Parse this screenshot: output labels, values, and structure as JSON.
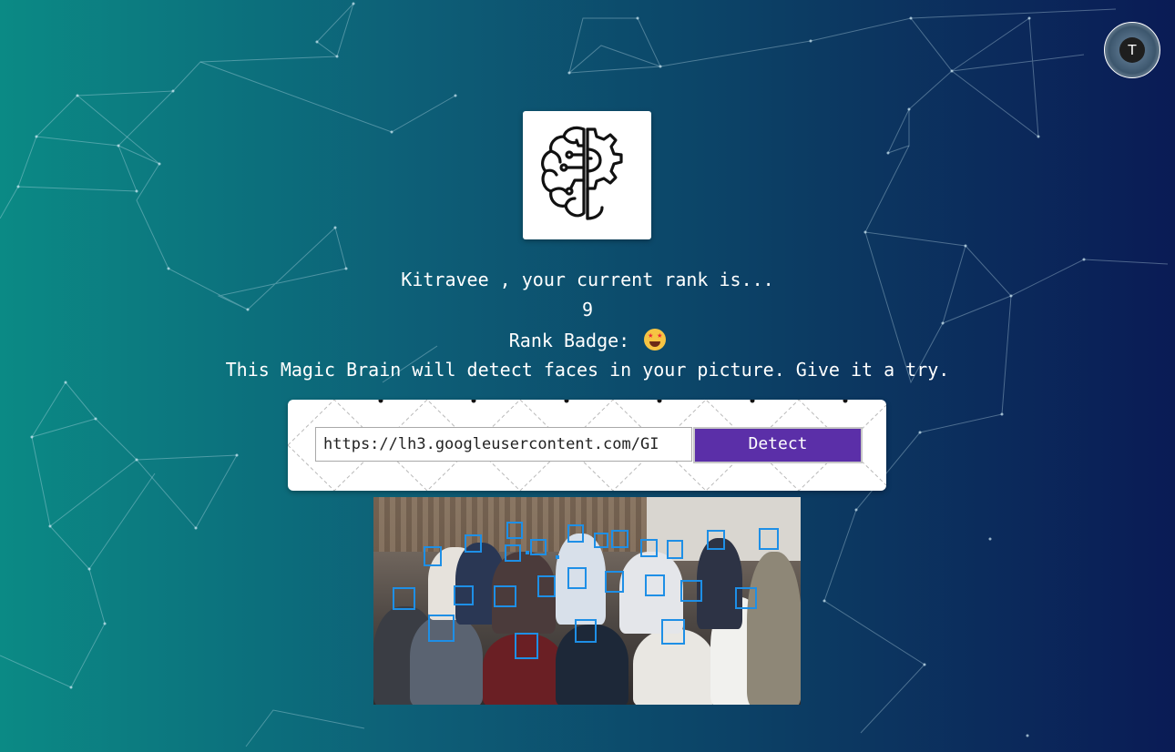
{
  "user": {
    "avatar_initial": "T"
  },
  "rank": {
    "prefix": "Kitravee , your current rank is...",
    "value": "9",
    "badge_label": "Rank Badge:",
    "badge_icon": "star-struck-emoji"
  },
  "description": "This Magic Brain will detect faces in your picture. Give it a try.",
  "form": {
    "url_value": "https://lh3.googleusercontent.com/GI",
    "detect_label": "Detect"
  },
  "colors": {
    "button": "#5b2fa8",
    "face_box": "#1e8fe6"
  },
  "faces_detected": 27
}
